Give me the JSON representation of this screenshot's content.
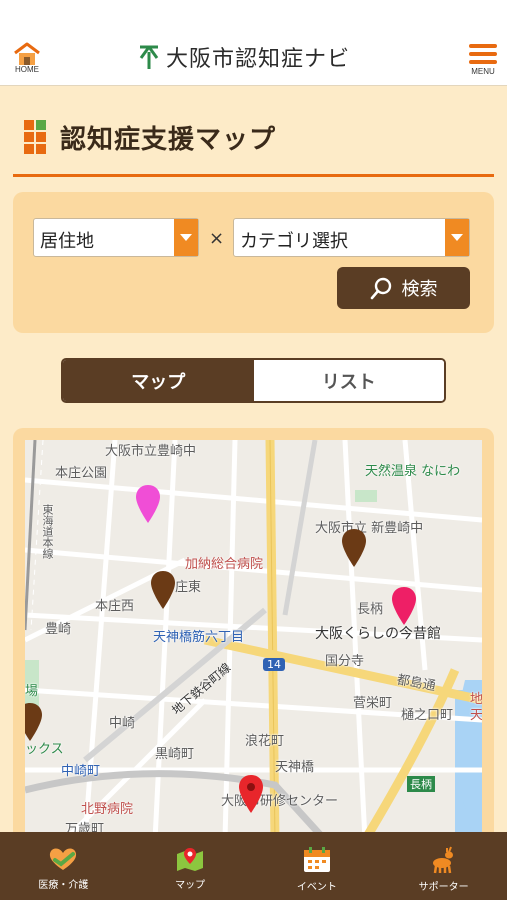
{
  "header": {
    "home_label": "HOME",
    "app_title": "大阪市認知症ナビ",
    "menu_label": "MENU"
  },
  "page": {
    "title": "認知症支援マップ"
  },
  "search": {
    "residence_select": "居住地",
    "times_symbol": "×",
    "category_select": "カテゴリ選択",
    "search_button": "検索"
  },
  "view_toggle": {
    "map_label": "マップ",
    "list_label": "リスト",
    "active": "マップ"
  },
  "map": {
    "labels": {
      "toyosaki_es": "大阪市立豊崎中",
      "honjo_park": "本庄公園",
      "onsen": "天然温泉 なにわ",
      "tokaido_line": "東海道本線",
      "shin_toyosaki": "大阪市立 新豊崎中",
      "kano_hospital": "加納総合病院",
      "honjo_higashi": "庄東",
      "honjo_nishi": "本庄西",
      "nagara": "長柄",
      "toyosaki": "豊崎",
      "tenroku_station": "天神橋筋六丁目",
      "kurashi_museum": "大阪くらしの今昔館",
      "kokubunji": "国分寺",
      "miyakojima_dori": "都島通",
      "sakuramiya": "菅栄町",
      "hinokuchi": "樋之口町",
      "nakatsu": "中崎",
      "subway_line": "地下鉄谷町線",
      "kurosaki": "黒崎町",
      "namihana": "浪花町",
      "nakazakicho_station": "中崎町",
      "tenjinbashi": "天神橋",
      "nagara_sign": "長柄",
      "kitano_hospital": "北野病院",
      "training_center": "大阪市研修センター",
      "banzai": "万歳町",
      "route_14": "14",
      "cross_left": "場",
      "cross_left2": "ックス",
      "tenma_edge": "地",
      "tenma_edge2": "天"
    },
    "pins": [
      {
        "color": "#f04ed6"
      },
      {
        "color": "#6b3a15"
      },
      {
        "color": "#6b3a15"
      },
      {
        "color": "#ee1f66"
      },
      {
        "color": "#6b3a15"
      },
      {
        "color": "#e8262b"
      }
    ]
  },
  "bottom_nav": {
    "items": [
      {
        "label": "医療・介護",
        "icon": "medical-care-icon"
      },
      {
        "label": "マップ",
        "icon": "map-icon"
      },
      {
        "label": "イベント",
        "icon": "calendar-icon"
      },
      {
        "label": "サポーター",
        "icon": "supporter-deer-icon"
      }
    ]
  },
  "colors": {
    "accent_orange": "#e86a10",
    "brown": "#5a3d24",
    "panel_bg": "#fbd9a0",
    "page_bg": "#fdebc8"
  }
}
